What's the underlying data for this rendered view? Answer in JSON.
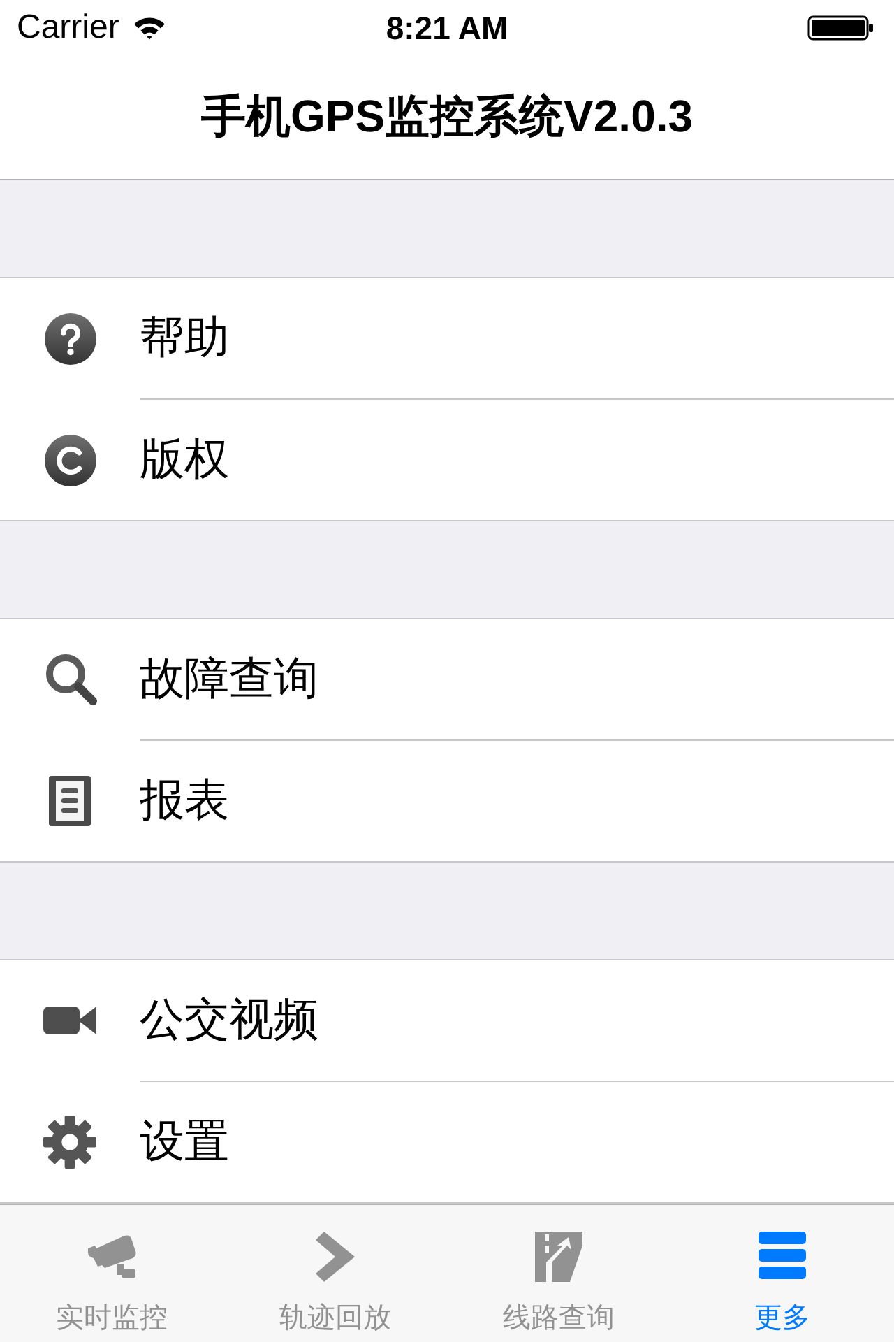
{
  "status_bar": {
    "carrier": "Carrier",
    "time": "8:21 AM"
  },
  "nav_bar": {
    "title": "手机GPS监控系统V2.0.3"
  },
  "sections": [
    {
      "items": [
        {
          "label": "帮助",
          "kind": "help"
        },
        {
          "label": "版权",
          "kind": "copyright"
        }
      ]
    },
    {
      "items": [
        {
          "label": "故障查询",
          "kind": "search"
        },
        {
          "label": "报表",
          "kind": "report"
        }
      ]
    },
    {
      "items": [
        {
          "label": "公交视频",
          "kind": "video"
        },
        {
          "label": "设置",
          "kind": "settings"
        }
      ]
    }
  ],
  "tab_bar": {
    "tabs": [
      {
        "label": "实时监控",
        "kind": "camera",
        "selected": false
      },
      {
        "label": "轨迹回放",
        "kind": "playback",
        "selected": false
      },
      {
        "label": "线路查询",
        "kind": "route",
        "selected": false
      },
      {
        "label": "更多",
        "kind": "more",
        "selected": true
      }
    ]
  }
}
